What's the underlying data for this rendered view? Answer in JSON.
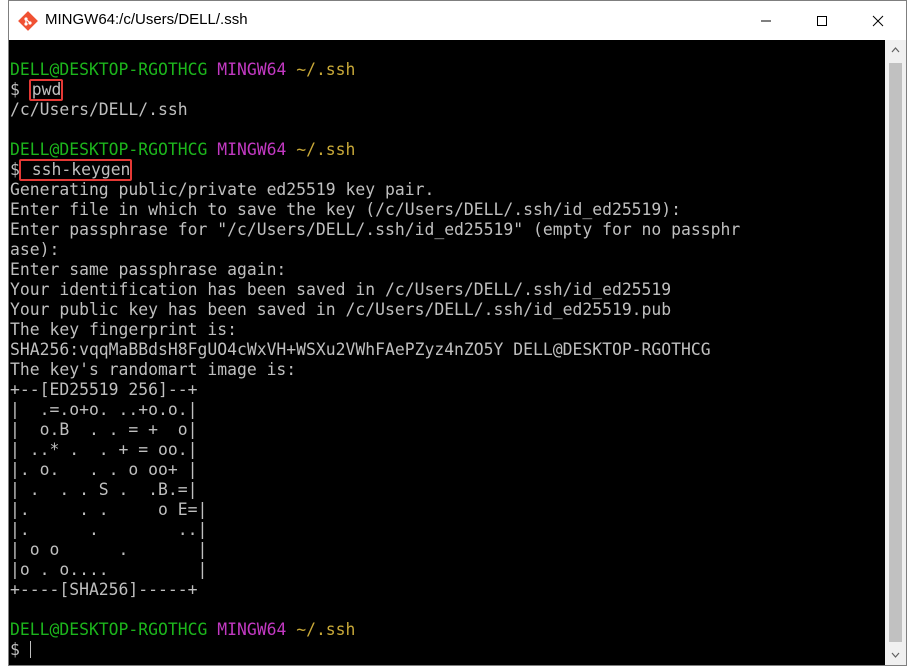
{
  "window": {
    "title": "MINGW64:/c/Users/DELL/.ssh",
    "icon": "git-bash-icon",
    "controls": [
      "minimize-icon",
      "maximize-icon",
      "close-icon"
    ]
  },
  "terminal": {
    "colors": {
      "user_host": "#1cb51c",
      "shell": "#c239c2",
      "path": "#c8a838",
      "text": "#bfbfbf",
      "highlight": "#e53935"
    },
    "prompt1": {
      "user_host": "DELL@DESKTOP-RGOTHCG",
      "shell": "MINGW64",
      "path": "~/.ssh"
    },
    "cmd1": {
      "dollar": "$",
      "command": "pwd"
    },
    "out1": "/c/Users/DELL/.ssh",
    "prompt2": {
      "user_host": "DELL@DESKTOP-RGOTHCG",
      "shell": "MINGW64",
      "path": "~/.ssh"
    },
    "cmd2": {
      "dollar": "$",
      "command": "ssh-keygen"
    },
    "output": [
      "Generating public/private ed25519 key pair.",
      "Enter file in which to save the key (/c/Users/DELL/.ssh/id_ed25519):",
      "Enter passphrase for \"/c/Users/DELL/.ssh/id_ed25519\" (empty for no passphr",
      "ase):",
      "Enter same passphrase again:",
      "Your identification has been saved in /c/Users/DELL/.ssh/id_ed25519",
      "Your public key has been saved in /c/Users/DELL/.ssh/id_ed25519.pub",
      "The key fingerprint is:",
      "SHA256:vqqMaBBdsH8FgUO4cWxVH+WSXu2VWhFAePZyz4nZO5Y DELL@DESKTOP-RGOTHCG",
      "The key's randomart image is:",
      "+--[ED25519 256]--+",
      "|  .=.o+o. ..+o.o.|",
      "|  o.B  . . = +  o|",
      "| ..* .  . + = oo.|",
      "|. o.   . . o oo+ |",
      "| .  . . S .  .B.=|",
      "|.     . .     o E=|",
      "|.      .        ..|",
      "| o o      .       |",
      "|o . o....         |",
      "+----[SHA256]-----+"
    ],
    "prompt3": {
      "user_host": "DELL@DESKTOP-RGOTHCG",
      "shell": "MINGW64",
      "path": "~/.ssh"
    },
    "final_dollar": "$"
  }
}
